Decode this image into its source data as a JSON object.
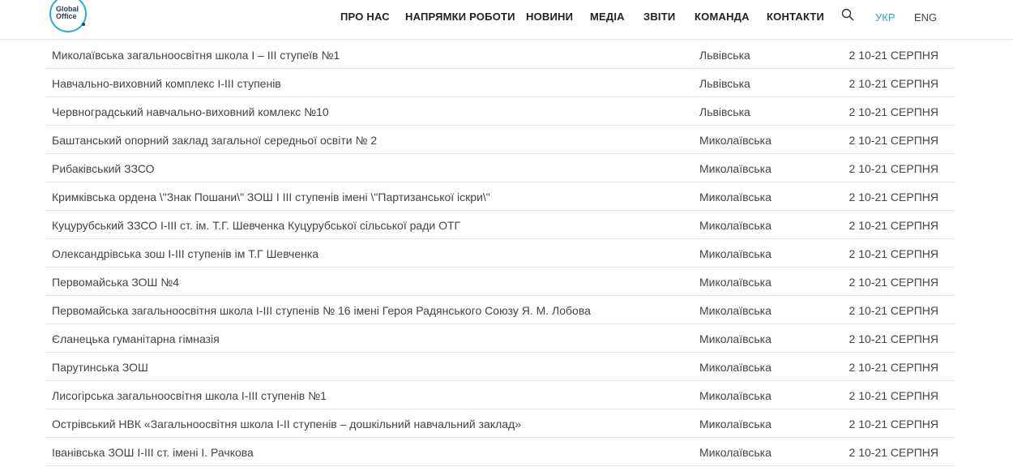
{
  "header": {
    "logo": {
      "line1": "Global",
      "line2": "Office"
    },
    "nav": [
      "ПРО НАС",
      "НАПРЯМКИ РОБОТИ",
      "НОВИНИ",
      "МЕДІА",
      "ЗВІТИ",
      "КОМАНДА",
      "КОНТАКТИ"
    ],
    "search_icon": "search-icon",
    "languages": {
      "active": "УКР",
      "other": "ENG"
    },
    "accent_color": "#2fa9dc"
  },
  "rows": [
    {
      "name": "Миколаївська загальноосвітня школа І – ІІІ ступеїв №1",
      "region": "Львівська",
      "date": "2 10-21 СЕРПНЯ"
    },
    {
      "name": "Навчально-виховний комплекс І-ІІІ ступенів",
      "region": "Львівська",
      "date": "2 10-21 СЕРПНЯ"
    },
    {
      "name": "Червноградський навчально-виховний комлекс №10",
      "region": "Львівська",
      "date": "2 10-21 СЕРПНЯ"
    },
    {
      "name": "Баштанський опорний заклад загальної середньої освіти № 2",
      "region": "Миколаївська",
      "date": "2 10-21 СЕРПНЯ"
    },
    {
      "name": "Рибаківський ЗЗСО",
      "region": "Миколаївська",
      "date": "2 10-21 СЕРПНЯ"
    },
    {
      "name": "Кримківська ордена \\\"Знак Пошани\\\" ЗОШ І  ІІІ ступенів імені \\\"Партизанської іскри\\\"",
      "region": "Миколаївська",
      "date": "2 10-21 СЕРПНЯ"
    },
    {
      "name": "Куцурубський ЗЗСО І-ІІІ ст. ім. Т.Г. Шевченка Куцурубської сільської ради ОТГ",
      "region": "Миколаївська",
      "date": "2 10-21 СЕРПНЯ"
    },
    {
      "name": "Олександрівська зош І-ІІІ ступенів ім Т.Г Шевченка",
      "region": "Миколаївська",
      "date": "2 10-21 СЕРПНЯ"
    },
    {
      "name": "Первомайська ЗОШ №4",
      "region": "Миколаївська",
      "date": "2 10-21 СЕРПНЯ"
    },
    {
      "name": "Первомайська загальноосвітня школа І-ІІІ ступенів № 16 імені Героя Радянського Союзу Я. М. Лобова",
      "region": "Миколаївська",
      "date": "2 10-21 СЕРПНЯ"
    },
    {
      "name": "Єланецька гуманітарна гімназія",
      "region": "Миколаївська",
      "date": "2 10-21 СЕРПНЯ"
    },
    {
      "name": "Парутинська ЗОШ",
      "region": "Миколаївська",
      "date": "2 10-21 СЕРПНЯ"
    },
    {
      "name": "Лисогірська загальноосвітня школа І-ІІІ ступенів №1",
      "region": "Миколаївська",
      "date": "2 10-21 СЕРПНЯ"
    },
    {
      "name": "Острівський НВК «Загальноосвітня школа І-ІІ ступенів – дошкільний навчальний заклад»",
      "region": "Миколаївська",
      "date": "2 10-21 СЕРПНЯ"
    },
    {
      "name": "Іванівська ЗОШ І-ІІІ ст. імені І. Рачкова",
      "region": "Миколаївська",
      "date": "2 10-21 СЕРПНЯ"
    }
  ]
}
